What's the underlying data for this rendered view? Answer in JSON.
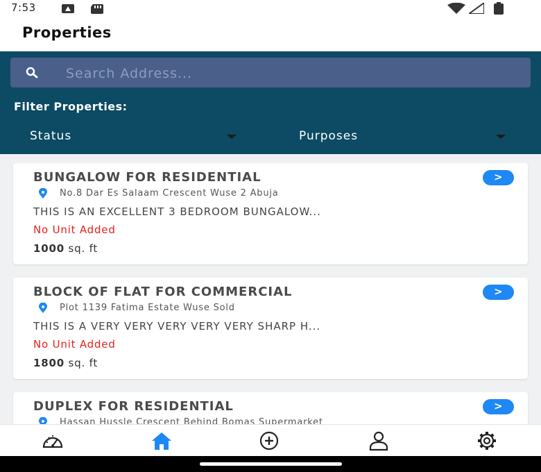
{
  "status_bar": {
    "time": "7:53"
  },
  "header": {
    "title": "Properties"
  },
  "search": {
    "placeholder": "Search Address..."
  },
  "filters": {
    "label": "Filter Properties:",
    "status_label": "Status",
    "purposes_label": "Purposes"
  },
  "properties": [
    {
      "title": "BUNGALOW FOR RESIDENTIAL",
      "address": "No.8 Dar Es Salaam Crescent Wuse 2 Abuja",
      "description": "THIS IS AN EXCELLENT 3 BEDROOM BUNGALOW...",
      "units": "No Unit Added",
      "size": "1000",
      "size_unit": "sq. ft",
      "action": ">"
    },
    {
      "title": "BLOCK OF FLAT FOR COMMERCIAL",
      "address": "Plot 1139 Fatima Estate Wuse Sold",
      "description": "THIS IS A VERY VERY VERY VERY VERY SHARP H...",
      "units": "No Unit Added",
      "size": "1800",
      "size_unit": "sq. ft",
      "action": ">"
    },
    {
      "title": "DUPLEX FOR RESIDENTIAL",
      "address": "Hassan Hussle Crescent Behind Bomas Supermarket",
      "action": ">"
    }
  ],
  "bottom_nav": [
    {
      "icon": "dashboard-icon",
      "active": false
    },
    {
      "icon": "home-icon",
      "active": true
    },
    {
      "icon": "add-circle-icon",
      "active": false
    },
    {
      "icon": "profile-icon",
      "active": false
    },
    {
      "icon": "settings-icon",
      "active": false
    }
  ],
  "colors": {
    "panel": "#0d4a63",
    "search_bg": "#4a5f8a",
    "accent": "#1e88f5",
    "alert": "#e8201a"
  }
}
